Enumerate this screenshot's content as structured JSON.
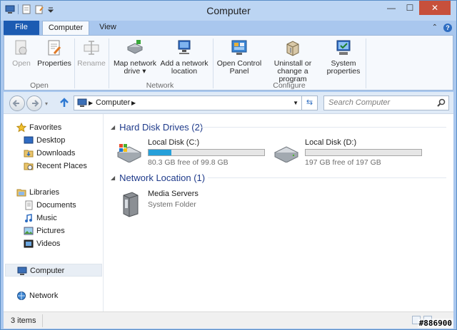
{
  "window": {
    "title": "Computer"
  },
  "tabs": [
    {
      "label": "File"
    },
    {
      "label": "Computer"
    },
    {
      "label": "View"
    }
  ],
  "ribbon": {
    "buttons": [
      {
        "label": "Open",
        "icon": "open-icon",
        "enabled": false
      },
      {
        "label": "Properties",
        "icon": "properties-icon",
        "enabled": true
      },
      {
        "label": "Rename",
        "icon": "rename-icon",
        "enabled": false
      },
      {
        "label": "Map network drive",
        "label_line1": "Map network",
        "label_line2": "drive ▾",
        "icon": "map-network-drive-icon",
        "enabled": true
      },
      {
        "label": "Add a network location",
        "label_line1": "Add a network",
        "label_line2": "location",
        "icon": "add-network-location-icon",
        "enabled": true
      },
      {
        "label": "Open Control Panel",
        "label_line1": "Open Control",
        "label_line2": "Panel",
        "icon": "control-panel-icon",
        "enabled": true
      },
      {
        "label": "Uninstall or change a program",
        "label_line1": "Uninstall or",
        "label_line2": "change a program",
        "icon": "uninstall-icon",
        "enabled": true
      },
      {
        "label": "System properties",
        "label_line1": "System",
        "label_line2": "properties",
        "icon": "system-properties-icon",
        "enabled": true
      }
    ],
    "groups": [
      {
        "label": "Open"
      },
      {
        "label": "Network"
      },
      {
        "label": "Configure"
      }
    ]
  },
  "address": {
    "crumb": "Computer"
  },
  "search": {
    "placeholder": "Search Computer"
  },
  "nav": {
    "favorites": {
      "label": "Favorites",
      "items": [
        "Desktop",
        "Downloads",
        "Recent Places"
      ]
    },
    "libraries": {
      "label": "Libraries",
      "items": [
        "Documents",
        "Music",
        "Pictures",
        "Videos"
      ]
    },
    "computer": {
      "label": "Computer"
    },
    "network": {
      "label": "Network"
    }
  },
  "groups": {
    "hdd": {
      "title": "Hard Disk Drives (2)"
    },
    "netloc": {
      "title": "Network Location (1)"
    }
  },
  "drives": [
    {
      "name": "Local Disk (C:)",
      "free": "80.3 GB free of 99.8 GB",
      "used_fraction": 0.195
    },
    {
      "name": "Local Disk (D:)",
      "free": "197 GB free of 197 GB",
      "used_fraction": 0.0
    }
  ],
  "network_location": {
    "name": "Media Servers",
    "type": "System Folder"
  },
  "status": {
    "count": "3 items"
  },
  "watermark": "#886900",
  "colors": {
    "accent": "#1c5bb2",
    "drive_bar": "#26a0da",
    "group_heading": "#1e3a8a"
  }
}
